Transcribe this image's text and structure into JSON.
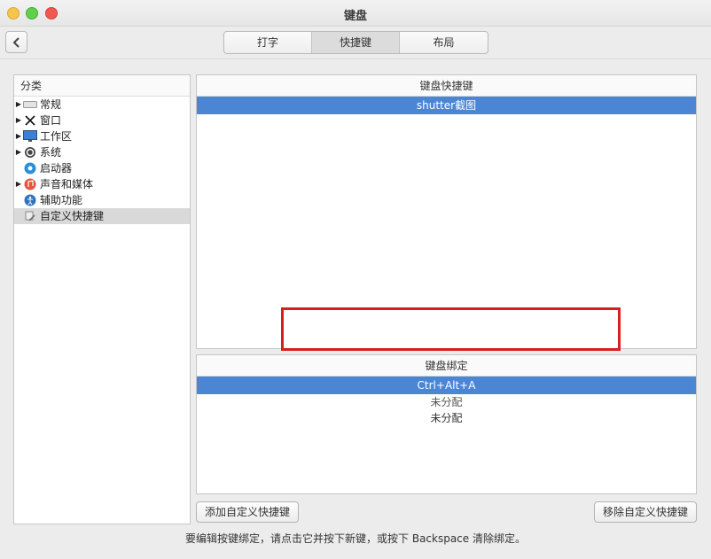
{
  "window": {
    "title": "键盘"
  },
  "tabs": [
    {
      "label": "打字",
      "active": false
    },
    {
      "label": "快捷键",
      "active": true
    },
    {
      "label": "布局",
      "active": false
    }
  ],
  "sidebar": {
    "header": "分类",
    "items": [
      {
        "label": "常规",
        "icon": "keyboard-icon",
        "expandable": true
      },
      {
        "label": "窗口",
        "icon": "window-x-icon",
        "expandable": true
      },
      {
        "label": "工作区",
        "icon": "monitor-icon",
        "expandable": true
      },
      {
        "label": "系统",
        "icon": "gear-icon",
        "expandable": true
      },
      {
        "label": "启动器",
        "icon": "launcher-icon",
        "expandable": false
      },
      {
        "label": "声音和媒体",
        "icon": "music-icon",
        "expandable": true
      },
      {
        "label": "辅助功能",
        "icon": "accessibility-icon",
        "expandable": false
      },
      {
        "label": "自定义快捷键",
        "icon": "custom-shortcut-icon",
        "expandable": false,
        "selected": true
      }
    ]
  },
  "shortcuts": {
    "header": "键盘快捷键",
    "rows": [
      "shutter截图"
    ]
  },
  "bindings": {
    "header": "键盘绑定",
    "rows": [
      "Ctrl+Alt+A",
      "未分配",
      "未分配"
    ]
  },
  "buttons": {
    "add": "添加自定义快捷键",
    "remove": "移除自定义快捷键"
  },
  "hint": "要编辑按键绑定，请点击它并按下新键，或按下 Backspace 清除绑定。",
  "colors": {
    "selection": "#4a86d4",
    "highlight": "#d81e1e"
  }
}
